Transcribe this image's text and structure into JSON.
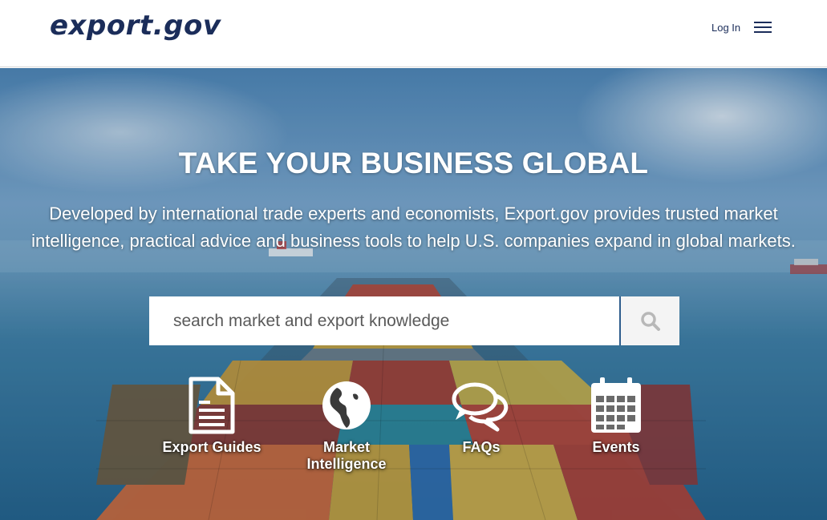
{
  "header": {
    "logo": "export.gov",
    "login_label": "Log In",
    "menu_icon": "hamburger-menu-icon"
  },
  "hero": {
    "title": "TAKE YOUR BUSINESS GLOBAL",
    "subtitle_line1": "Developed by international trade experts and economists, Export.gov provides trusted market",
    "subtitle_line2": "intelligence, practical advice and business tools to help U.S. companies expand in global markets."
  },
  "search": {
    "placeholder": "search market and export knowledge",
    "value": "",
    "button_icon": "search-icon"
  },
  "quick_links": [
    {
      "label": "Export Guides",
      "icon": "document-icon"
    },
    {
      "label": "Market Intelligence",
      "label_line1": "Market",
      "label_line2": "Intelligence",
      "icon": "globe-icon"
    },
    {
      "label": "FAQs",
      "icon": "speech-bubbles-icon"
    },
    {
      "label": "Events",
      "icon": "calendar-icon"
    }
  ],
  "colors": {
    "brand_navy": "#1b2d5a",
    "search_accent": "#2e5d8c",
    "hero_text": "#ffffff"
  }
}
